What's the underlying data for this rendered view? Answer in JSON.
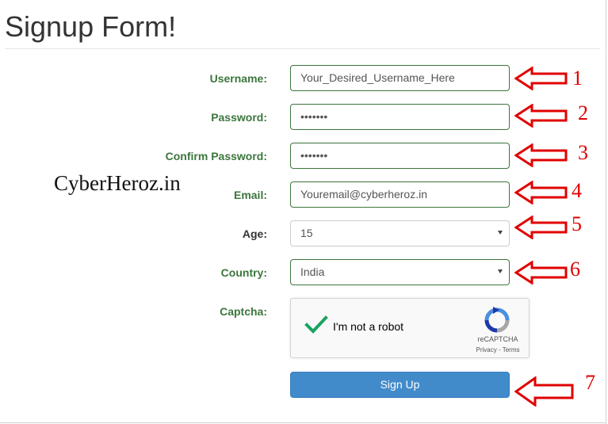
{
  "page": {
    "title": "Signup Form!",
    "watermark": "CyberHeroz.in"
  },
  "form": {
    "username": {
      "label": "Username:",
      "value": "Your_Desired_Username_Here"
    },
    "password": {
      "label": "Password:",
      "value": "•••••••"
    },
    "confirm_password": {
      "label": "Confirm Password:",
      "value": "•••••••"
    },
    "email": {
      "label": "Email:",
      "value": "Youremail@cyberheroz.in"
    },
    "age": {
      "label": "Age:",
      "value": "15"
    },
    "country": {
      "label": "Country:",
      "value": "India"
    },
    "captcha": {
      "label": "Captcha:",
      "checkbox_text": "I'm not a robot",
      "brand": "reCAPTCHA",
      "links": "Privacy - Terms",
      "checked": true
    },
    "submit_label": "Sign Up"
  },
  "annotations": {
    "color": "#e00000",
    "numbers": [
      "1",
      "2",
      "3",
      "4",
      "5",
      "6",
      "7"
    ]
  },
  "colors": {
    "success_green": "#3c763d",
    "primary_button": "#428bca",
    "check_green": "#1aa260"
  }
}
